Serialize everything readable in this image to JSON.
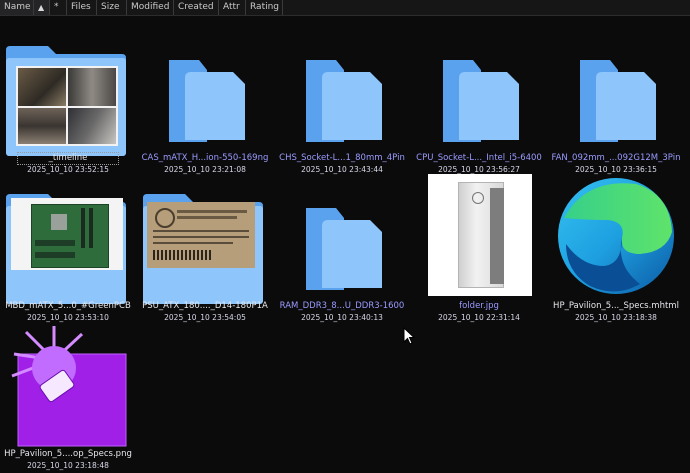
{
  "header": {
    "columns": [
      "Name",
      "*",
      "Files",
      "Size",
      "Modified",
      "Created",
      "Attr",
      "Rating"
    ],
    "sort_icon": "sort-up-arrow-icon"
  },
  "items": [
    {
      "name": "_timeline",
      "date": "2025_10_10 23:52:15",
      "kind": "folder-with-photos"
    },
    {
      "name": "CAS_mATX_H...ion-550-169ng",
      "date": "2025_10_10 23:21:08",
      "kind": "folder"
    },
    {
      "name": "CHS_Socket-L...1_80mm_4Pin",
      "date": "2025_10_10 23:43:44",
      "kind": "folder"
    },
    {
      "name": "CPU_Socket-L..._Intel_i5-6400",
      "date": "2025_10_10 23:56:27",
      "kind": "folder"
    },
    {
      "name": "FAN_092mm_...092G12M_3Pin",
      "date": "2025_10_10 23:36:15",
      "kind": "folder"
    },
    {
      "name": "MBD_mATX_5...0_#GreenPCB",
      "date": "2025_10_10 23:53:10",
      "kind": "folder-with-photo"
    },
    {
      "name": "PSU_ATX_180...._D14-180P1A",
      "date": "2025_10_10 23:54:05",
      "kind": "folder-with-photo"
    },
    {
      "name": "RAM_DDR3_8...U_DDR3-1600",
      "date": "2025_10_10 23:40:13",
      "kind": "folder"
    },
    {
      "name": "folder.jpg",
      "date": "2025_10_10 22:31:14",
      "kind": "image"
    },
    {
      "name": "HP_Pavilion_5..._Specs.mhtml",
      "date": "2025_10_10 23:18:38",
      "kind": "edge-document"
    },
    {
      "name": "HP_Pavilion_5....op_Specs.png",
      "date": "2025_10_10 23:18:48",
      "kind": "image-editor-file"
    }
  ],
  "colors": {
    "background": "#0b0b0c",
    "folder": "#8ec5fa",
    "folder_dark": "#5aa2ee",
    "caption": "#9b9bff",
    "date": "#d8d8e8"
  }
}
